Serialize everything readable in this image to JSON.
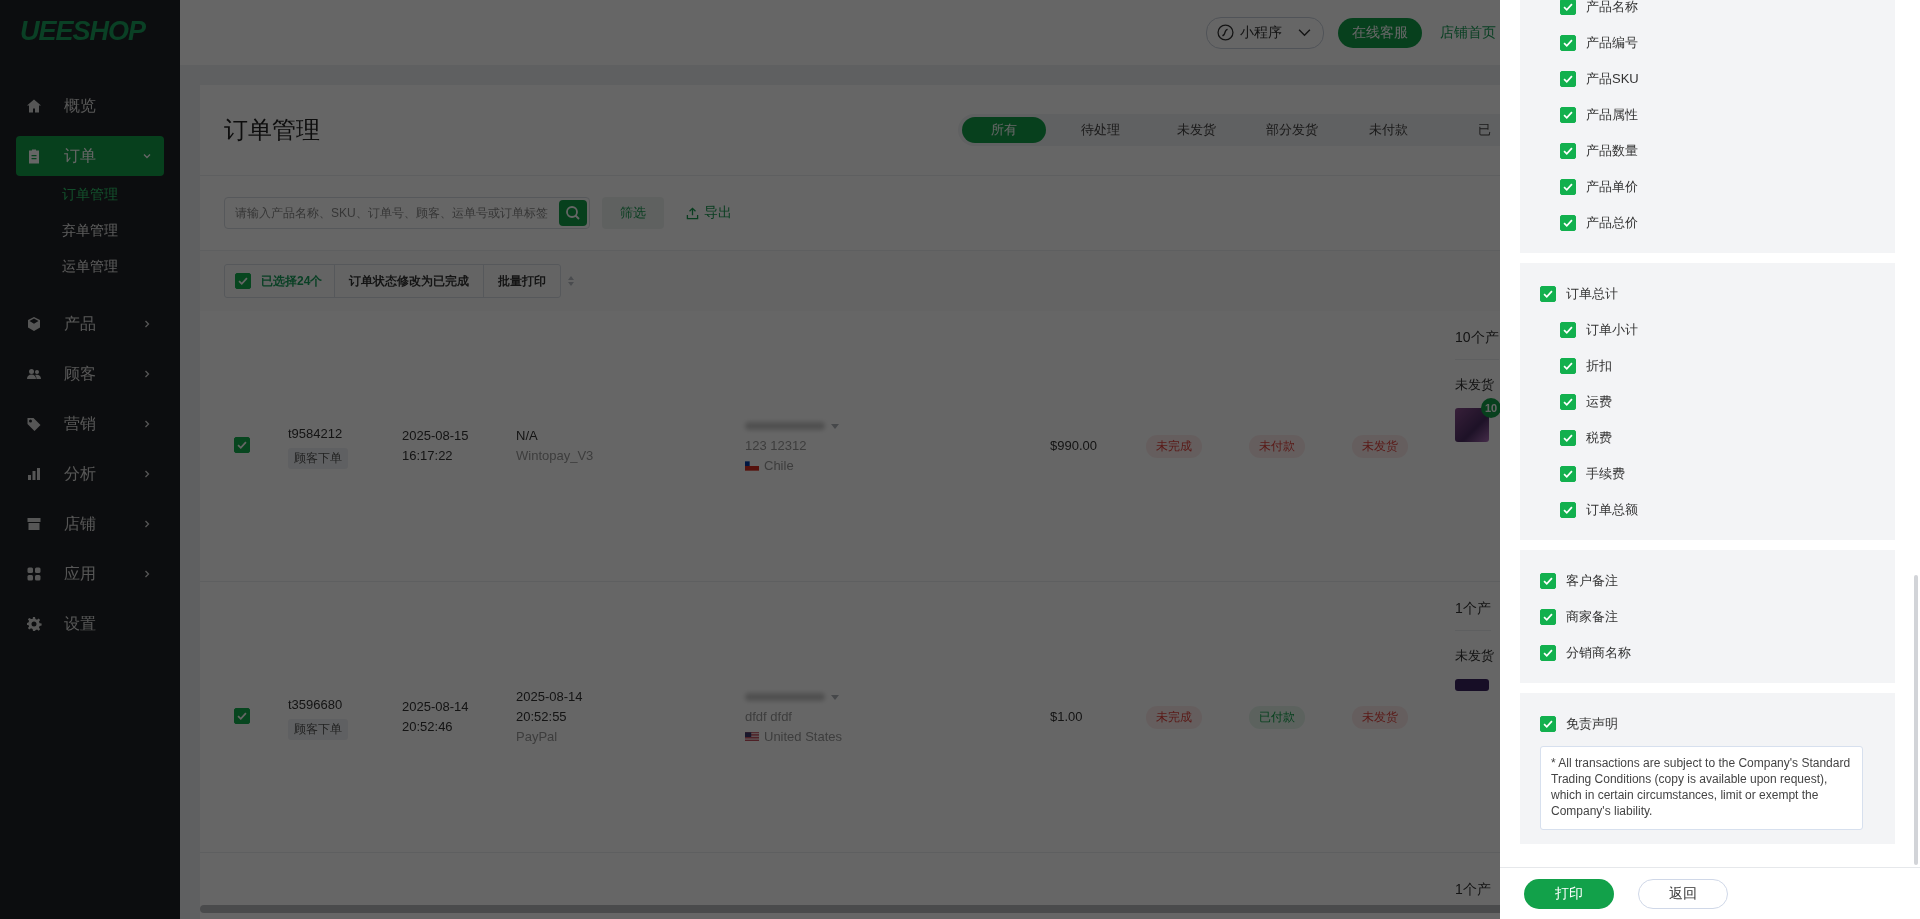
{
  "sidebar": {
    "logo": "UEESHOP",
    "items": [
      {
        "label": "概览",
        "selected": false
      },
      {
        "label": "订单",
        "selected": true,
        "expanded": true,
        "children": [
          {
            "label": "订单管理",
            "selected": true
          },
          {
            "label": "弃单管理",
            "selected": false
          },
          {
            "label": "运单管理",
            "selected": false
          }
        ]
      },
      {
        "label": "产品",
        "selected": false,
        "expanded": false
      },
      {
        "label": "顾客",
        "selected": false,
        "expanded": false
      },
      {
        "label": "营销",
        "selected": false,
        "expanded": false
      },
      {
        "label": "分析",
        "selected": false,
        "expanded": false
      },
      {
        "label": "店铺",
        "selected": false,
        "expanded": false
      },
      {
        "label": "应用",
        "selected": false,
        "expanded": false
      },
      {
        "label": "设置",
        "selected": false
      }
    ]
  },
  "header": {
    "mini_program": "小程序",
    "support_button": "在线客服",
    "store_link": "店铺首页"
  },
  "page": {
    "title": "订单管理",
    "tabs": [
      {
        "label": "所有",
        "selected": true
      },
      {
        "label": "待处理",
        "selected": false
      },
      {
        "label": "未发货",
        "selected": false
      },
      {
        "label": "部分发货",
        "selected": false
      },
      {
        "label": "未付款",
        "selected": false
      },
      {
        "label": "已",
        "selected": false
      }
    ]
  },
  "toolbar": {
    "search": {
      "placeholder": "请输入产品名称、SKU、订单号、顾客、运单号或订单标签"
    },
    "filter_button": "筛选",
    "export_button": "导出"
  },
  "bulk_bar": {
    "checked": true,
    "selected_count": "已选择24个",
    "actions": [
      "订单状态修改为已完成",
      "批量打印"
    ]
  },
  "orders": [
    {
      "checked": true,
      "order_no": "t9584212",
      "source": "顾客下单",
      "date": "2025-08-15",
      "time": "16:17:22",
      "payment_time": [
        "N/A"
      ],
      "payment_method": "Wintopay_V3",
      "customer_name": "123 12312",
      "country": "Chile",
      "amount": "$990.00",
      "statuses": [
        {
          "text": "未完成",
          "done": false
        },
        {
          "text": "未付款",
          "done": false
        },
        {
          "text": "未发货",
          "done": false
        }
      ],
      "product_count": "10个产",
      "fulfillment": "未发货",
      "thumbnail_badge": "10"
    },
    {
      "checked": true,
      "order_no": "t3596680",
      "source": "顾客下单",
      "date": "2025-08-14",
      "time": "20:52:46",
      "payment_time": [
        "2025-08-14",
        "20:52:55"
      ],
      "payment_method": "PayPal",
      "customer_name": "dfdf dfdf",
      "country": "United States",
      "amount": "$1.00",
      "statuses": [
        {
          "text": "未完成",
          "done": false
        },
        {
          "text": "已付款",
          "done": true
        },
        {
          "text": "未发货",
          "done": false
        }
      ],
      "product_count": "1个产",
      "fulfillment": "未发货"
    },
    {
      "product_count": "1个产"
    }
  ],
  "print_drawer": {
    "sections": [
      {
        "items": [
          {
            "children": [
              {
                "label": "产品名称",
                "checked": true
              },
              {
                "label": "产品编号",
                "checked": true
              },
              {
                "label": "产品SKU",
                "checked": true
              },
              {
                "label": "产品属性",
                "checked": true
              },
              {
                "label": "产品数量",
                "checked": true
              },
              {
                "label": "产品单价",
                "checked": true
              },
              {
                "label": "产品总价",
                "checked": true
              }
            ]
          }
        ]
      },
      {
        "items": [
          {
            "label": "订单总计",
            "checked": true,
            "children": [
              {
                "label": "订单小计",
                "checked": true
              },
              {
                "label": "折扣",
                "checked": true
              },
              {
                "label": "运费",
                "checked": true
              },
              {
                "label": "税费",
                "checked": true
              },
              {
                "label": "手续费",
                "checked": true
              },
              {
                "label": "订单总额",
                "checked": true
              }
            ]
          }
        ]
      },
      {
        "items": [
          {
            "label": "客户备注",
            "checked": true
          },
          {
            "label": "商家备注",
            "checked": true
          },
          {
            "label": "分销商名称",
            "checked": true
          }
        ]
      }
    ],
    "disclaimer": {
      "label": "免责声明",
      "checked": true,
      "text": "* All transactions are subject to the Company's Standard Trading Conditions (copy is available upon request), which in certain circumstances, limit or exempt the Company's liability."
    },
    "buttons": [
      {
        "label": "打印",
        "kind": "primary"
      },
      {
        "label": "返回",
        "kind": "secondary"
      }
    ]
  }
}
